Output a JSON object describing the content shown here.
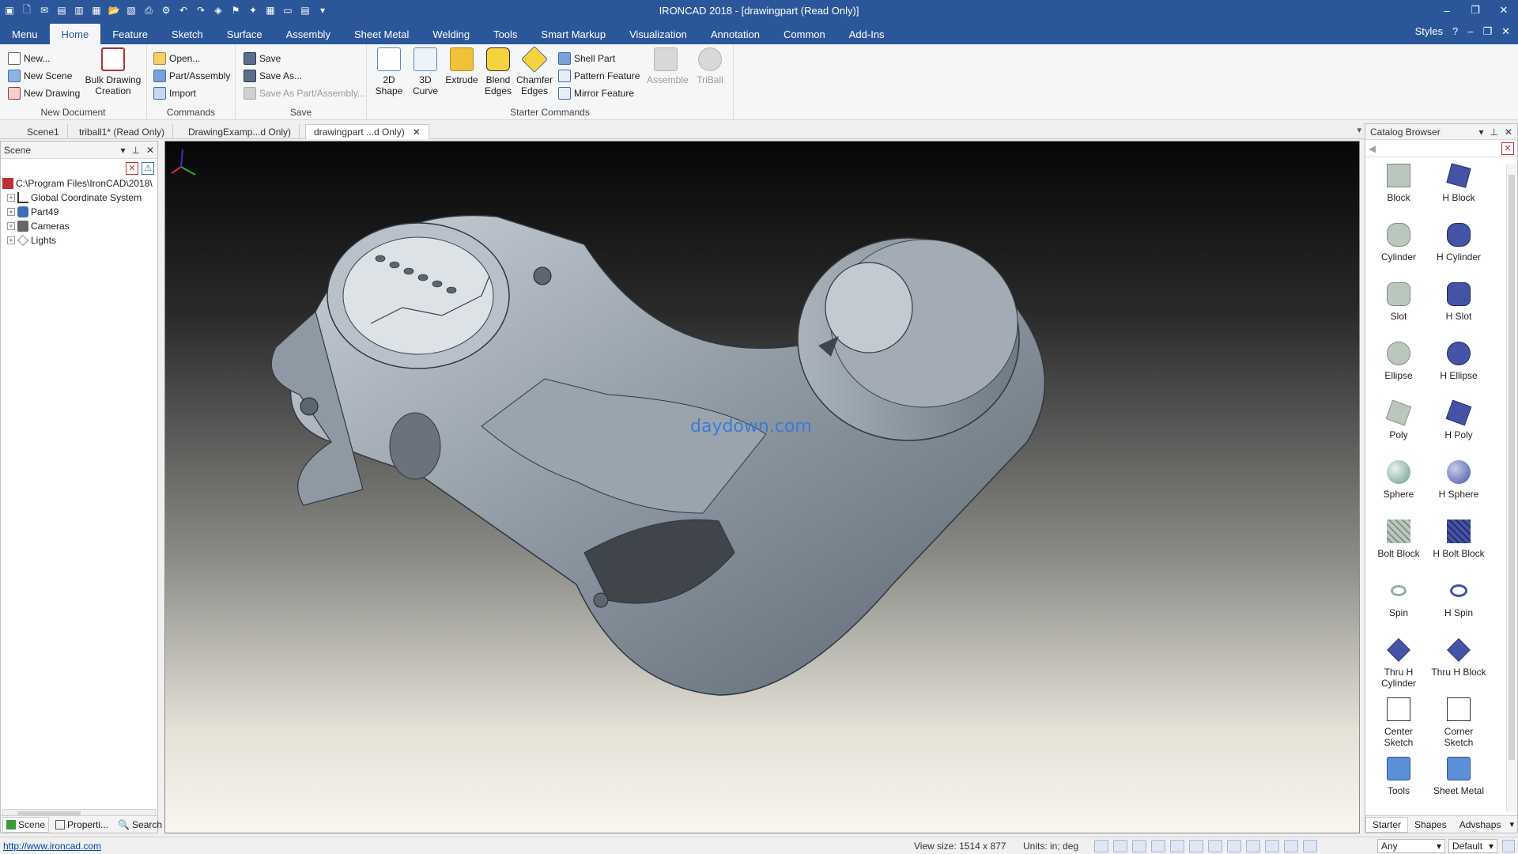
{
  "app": {
    "title": "IRONCAD 2018 - [drawingpart (Read Only)]"
  },
  "quick_access": [
    "app-icon",
    "new-icon",
    "open-icon",
    "save-icon",
    "print-icon",
    "undo-icon",
    "redo-icon",
    "customize-icon"
  ],
  "window_controls": {
    "minimize": "–",
    "restore": "❐",
    "close": "✕"
  },
  "menu_tabs": [
    "Menu",
    "Home",
    "Feature",
    "Sketch",
    "Surface",
    "Assembly",
    "Sheet Metal",
    "Welding",
    "Tools",
    "Smart Markup",
    "Visualization",
    "Annotation",
    "Common",
    "Add-Ins"
  ],
  "menu_active": "Home",
  "menu_right": {
    "styles": "Styles",
    "help": "?",
    "minimize": "–",
    "restore": "❐",
    "close": "✕"
  },
  "ribbon": {
    "new_document": {
      "label": "New Document",
      "new": "New...",
      "new_scene": "New Scene",
      "new_drawing": "New Drawing",
      "bulk_drawing": "Bulk Drawing Creation"
    },
    "commands": {
      "label": "Commands",
      "open": "Open...",
      "part_assembly": "Part/Assembly",
      "import": "Import"
    },
    "save": {
      "label": "Save",
      "save": "Save",
      "save_as": "Save As...",
      "save_as_part": "Save As Part/Assembly..."
    },
    "starter": {
      "label": "Starter Commands",
      "shape2d": "2D Shape",
      "curve3d": "3D Curve",
      "extrude": "Extrude",
      "blend_edges": "Blend Edges",
      "chamfer_edges": "Chamfer Edges",
      "shell_part": "Shell Part",
      "pattern_feature": "Pattern Feature",
      "mirror_feature": "Mirror Feature",
      "assemble": "Assemble",
      "triball": "TriBall"
    }
  },
  "doc_tabs": [
    "Scene1",
    "triball1* (Read Only)",
    "DrawingExamp...d Only)",
    "drawingpart ...d Only)"
  ],
  "doc_tab_active": "drawingpart ...d Only)",
  "scene_panel": {
    "title": "Scene",
    "tree": [
      {
        "label": "C:\\Program Files\\IronCAD\\2018\\",
        "icon": "scene-root-icon"
      },
      {
        "label": "Global Coordinate System",
        "icon": "coordinate-system-icon"
      },
      {
        "label": "Part49",
        "icon": "part-icon"
      },
      {
        "label": "Cameras",
        "icon": "camera-icon"
      },
      {
        "label": "Lights",
        "icon": "light-icon"
      }
    ],
    "tabs": [
      "Scene",
      "Properti...",
      "Search"
    ]
  },
  "viewport": {
    "watermark": "daydown.com"
  },
  "catalog": {
    "title": "Catalog Browser",
    "items": [
      [
        "Block",
        "H Block"
      ],
      [
        "Cylinder",
        "H Cylinder"
      ],
      [
        "Slot",
        "H Slot"
      ],
      [
        "Ellipse",
        "H Ellipse"
      ],
      [
        "Poly",
        "H Poly"
      ],
      [
        "Sphere",
        "H Sphere"
      ],
      [
        "Bolt Block",
        "H Bolt Block"
      ],
      [
        "Spin",
        "H Spin"
      ],
      [
        "Thru H Cylinder",
        "Thru H Block"
      ],
      [
        "Center Sketch",
        "Corner Sketch"
      ],
      [
        "Tools",
        "Sheet Metal"
      ]
    ],
    "tabs": [
      "Starter",
      "Shapes",
      "Advshaps"
    ]
  },
  "status": {
    "url": "http://www.ironcad.com",
    "view_size": "View size: 1514 x 877",
    "units": "Units: in; deg",
    "select_any": "Any",
    "select_default": "Default"
  },
  "colors": {
    "title_bar": "#2b579a",
    "accent": "#2b579a"
  }
}
